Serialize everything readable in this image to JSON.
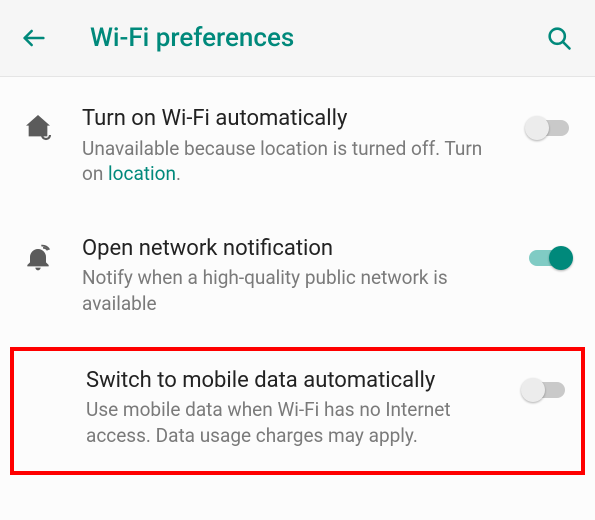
{
  "header": {
    "title": "Wi-Fi preferences"
  },
  "items": [
    {
      "title": "Turn on Wi-Fi automatically",
      "sub_before": "Unavailable because location is turned off. Turn on ",
      "link": "location",
      "sub_after": ".",
      "toggle": "off"
    },
    {
      "title": "Open network notification",
      "sub": "Notify when a high-quality public network is available",
      "toggle": "on"
    },
    {
      "title": "Switch to mobile data automatically",
      "sub": "Use mobile data when Wi-Fi has no Internet access. Data usage charges may apply.",
      "toggle": "off"
    }
  ]
}
